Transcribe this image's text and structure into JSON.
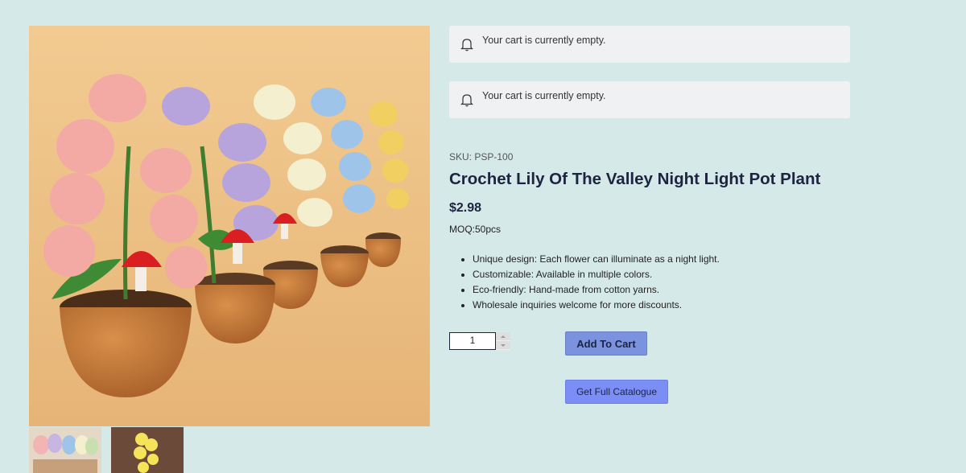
{
  "notices": [
    {
      "icon": "bell-icon",
      "message": "Your cart is currently empty."
    },
    {
      "icon": "bell-icon",
      "message": "Your cart is currently empty."
    }
  ],
  "product": {
    "sku": "SKU: PSP-100",
    "title": "Crochet Lily Of The Valley Night Light Pot Plant",
    "price": "$2.98",
    "moq": "MOQ:50pcs",
    "features": [
      "Unique design: Each flower can illuminate as a night light.",
      "Customizable: Available in multiple colors.",
      "Eco-friendly: Hand-made from cotton yarns.",
      "Wholesale inquiries welcome for more discounts."
    ]
  },
  "purchase": {
    "quantity": "1",
    "add_to_cart_label": "Add To Cart",
    "catalogue_label": "Get Full Catalogue"
  },
  "colors": {
    "page_background": "#d5e9e9",
    "primary_button": "#7b93de",
    "secondary_button": "#7b8ef5",
    "title_text": "#1c2440"
  }
}
